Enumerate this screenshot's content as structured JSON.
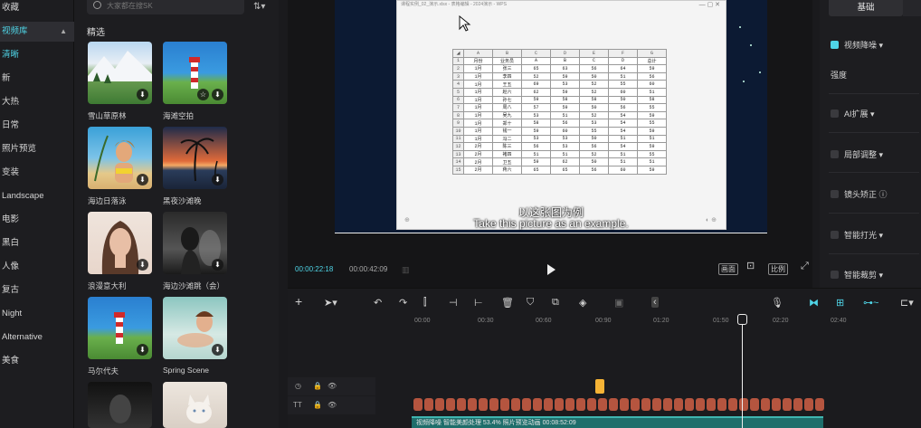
{
  "categories": {
    "favorites": "收藏",
    "library": "视频库",
    "library_sub": "清晰",
    "items": [
      "新",
      "大热",
      "日常",
      "照片预览",
      "变装",
      "Landscape",
      "电影",
      "黑白",
      "人像",
      "复古",
      "Night",
      "Alternative",
      "美食"
    ]
  },
  "library": {
    "search_placeholder": "大家都在搜SK",
    "section_title": "精选",
    "cards": [
      {
        "caption": "雪山草原林"
      },
      {
        "caption": "海滩空拍"
      },
      {
        "caption": "海边日落泳"
      },
      {
        "caption": "黑夜沙滩晚"
      },
      {
        "caption": "浪漫意大利"
      },
      {
        "caption": "海边沙滩跳（会）"
      },
      {
        "caption": "马尔代夫"
      },
      {
        "caption": "Spring Scene"
      }
    ]
  },
  "player": {
    "window_title": "课程实例_02_演示.xlsx - 表格编辑 - 2024演示 - WPS",
    "subtitle_cn": "以这张图为例",
    "subtitle_en": "Take this picture as an example.",
    "time_current": "00:00:22:18",
    "time_total": "00:00:42:09",
    "btn_fit": "画面",
    "btn_ratio": "比例",
    "sheet": {
      "col_headers": [
        "A",
        "B",
        "C",
        "D",
        "E",
        "F",
        "G"
      ],
      "rows": [
        [
          "月份",
          "业务员",
          "A",
          "B",
          "C",
          "D",
          "总计"
        ],
        [
          "1月",
          "张三",
          "65",
          "63",
          "56",
          "64",
          "59"
        ],
        [
          "1月",
          "李四",
          "52",
          "59",
          "50",
          "51",
          "56"
        ],
        [
          "1月",
          "王五",
          "69",
          "53",
          "52",
          "55",
          "60"
        ],
        [
          "1月",
          "赵六",
          "62",
          "59",
          "52",
          "60",
          "51"
        ],
        [
          "1月",
          "孙七",
          "59",
          "58",
          "58",
          "50",
          "58"
        ],
        [
          "1月",
          "周八",
          "57",
          "59",
          "50",
          "56",
          "55"
        ],
        [
          "1月",
          "吴九",
          "53",
          "51",
          "52",
          "54",
          "59"
        ],
        [
          "1月",
          "郑十",
          "58",
          "56",
          "53",
          "54",
          "55"
        ],
        [
          "1月",
          "钱一",
          "59",
          "60",
          "55",
          "54",
          "59"
        ],
        [
          "1月",
          "冯二",
          "53",
          "53",
          "50",
          "51",
          "51"
        ],
        [
          "2月",
          "陈三",
          "56",
          "53",
          "56",
          "54",
          "59"
        ],
        [
          "2月",
          "褚四",
          "51",
          "51",
          "52",
          "51",
          "55"
        ],
        [
          "2月",
          "卫五",
          "59",
          "62",
          "50",
          "51",
          "51"
        ],
        [
          "2月",
          "蒋六",
          "65",
          "65",
          "56",
          "60",
          "59"
        ]
      ]
    }
  },
  "right_panel": {
    "tab_basic": "基础",
    "video_effect": "视频降噪",
    "strength_label": "强度",
    "ai_extend": "AI扩展",
    "smart_color": "局部调整",
    "lens_correction": "镜头矫正",
    "smart_light": "智能打光",
    "smart_crop": "智能裁剪"
  },
  "timeline": {
    "ruler": [
      "00:00",
      "00:30",
      "00:60",
      "00:90",
      "01:20",
      "01:50",
      "02:20",
      "02:40"
    ],
    "track_tt": "TT",
    "main_clip": "视频降噪  智能美颜处理 53.4%  照片预览动画 00:08:52:09"
  }
}
